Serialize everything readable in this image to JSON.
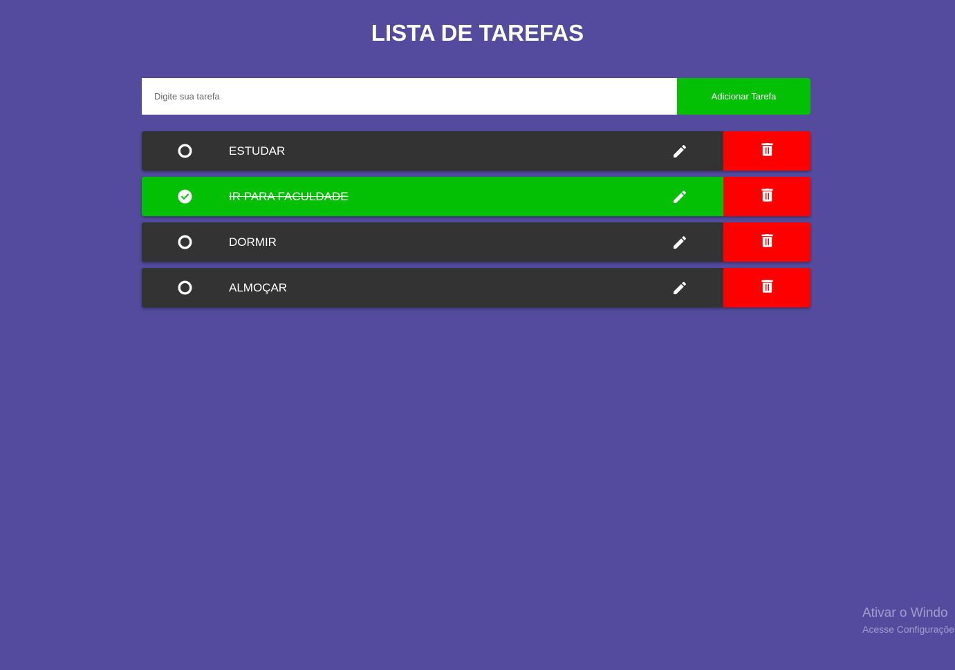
{
  "header": {
    "title": "LISTA DE TAREFAS"
  },
  "add_form": {
    "placeholder": "Digite sua tarefa",
    "value": "",
    "button_label": "Adicionar Tarefa"
  },
  "tasks": [
    {
      "label": "ESTUDAR",
      "completed": false
    },
    {
      "label": "IR PARA FACULDADE",
      "completed": true
    },
    {
      "label": "DORMIR",
      "completed": false
    },
    {
      "label": "ALMOÇAR",
      "completed": false
    }
  ],
  "icons": {
    "unchecked": "circle-outline-icon",
    "checked": "check-circle-icon",
    "edit": "pencil-icon",
    "delete": "trash-icon"
  },
  "colors": {
    "background": "#544b9f",
    "accent_green": "#04c004",
    "delete_red": "#ff0000",
    "task_dark": "#333333"
  },
  "watermark": {
    "title": "Ativar o Windo",
    "subtitle": "Acesse Configuraçõe"
  }
}
